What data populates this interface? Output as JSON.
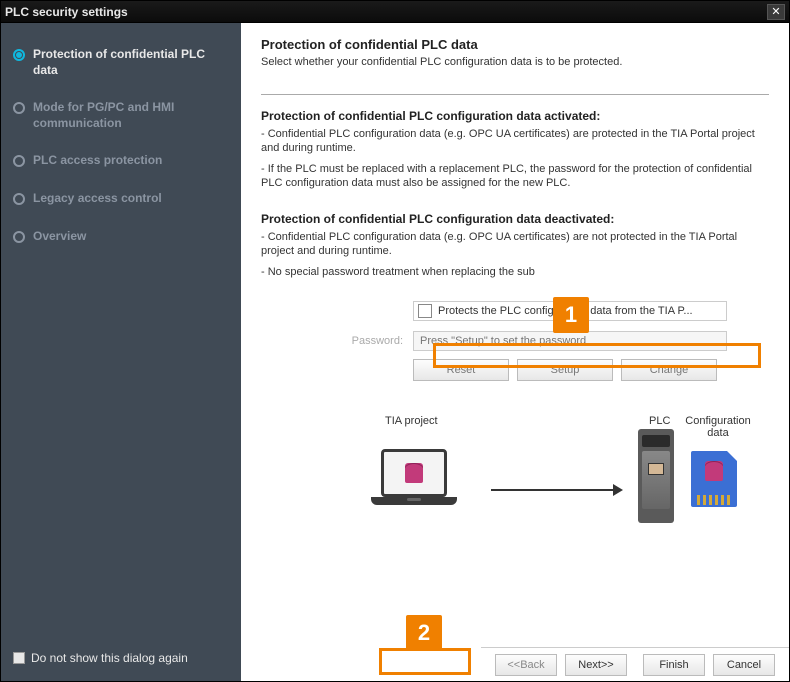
{
  "titlebar": {
    "title": "PLC security settings"
  },
  "sidebar": {
    "items": [
      {
        "label": "Protection of confidential PLC data",
        "active": true
      },
      {
        "label": "Mode for PG/PC and HMI communication",
        "active": false
      },
      {
        "label": "PLC access protection",
        "active": false
      },
      {
        "label": "Legacy access control",
        "active": false
      },
      {
        "label": "Overview",
        "active": false
      }
    ],
    "dont_show_label": "Do not show this dialog again"
  },
  "content": {
    "title": "Protection of confidential PLC data",
    "subtitle": "Select whether your confidential PLC configuration data is to be protected.",
    "activated": {
      "heading": "Protection of confidential PLC configuration data activated:",
      "line1": "- Confidential PLC configuration data (e.g. OPC UA certificates) are protected in the TIA Portal project and during runtime.",
      "line2": "- If the PLC must be replaced with a replacement PLC, the password for the protection of confidential PLC configuration data must also be assigned for the new PLC."
    },
    "deactivated": {
      "heading": "Protection of confidential PLC configuration data deactivated:",
      "line1": "- Confidential PLC configuration data (e.g. OPC UA certificates) are not protected in the TIA Portal project and during runtime.",
      "line2": "- No special password treatment when replacing the sub"
    },
    "form": {
      "checkbox_label": "Protects the PLC configuration data from the TIA P...",
      "password_label": "Password:",
      "password_placeholder": "Press \"Setup\" to set the password",
      "reset": "Reset",
      "setup": "Setup",
      "change": "Change"
    },
    "diagram": {
      "tia_label": "TIA project",
      "plc_label": "PLC",
      "config_label": "Configuration data"
    }
  },
  "footer": {
    "back": "<<Back",
    "next": "Next>>",
    "finish": "Finish",
    "cancel": "Cancel"
  },
  "callouts": {
    "one": "1",
    "two": "2"
  }
}
